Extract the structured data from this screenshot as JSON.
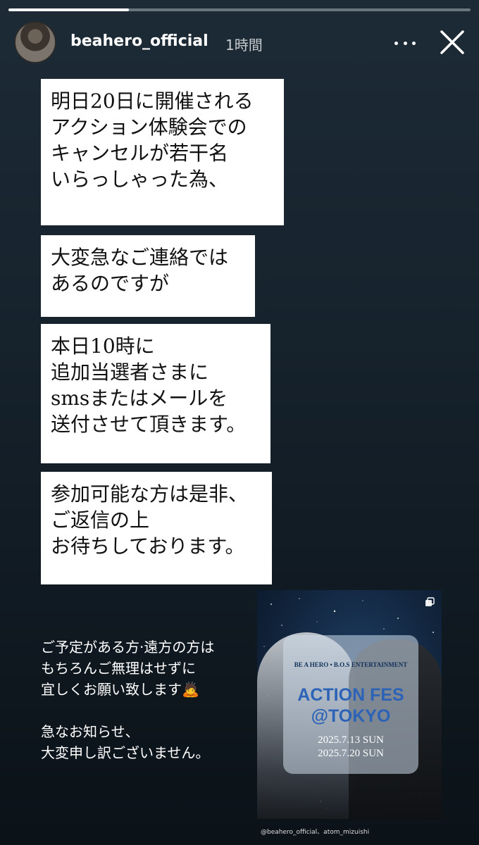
{
  "story": {
    "progress": 0.26
  },
  "header": {
    "username": "beahero_official",
    "time": "1時間",
    "more_icon": "more-horizontal-icon",
    "close_icon": "close-icon"
  },
  "bubbles": [
    "明日20日に開催される\nアクション体験会での\nキャンセルが若干名\nいらっしゃった為、",
    "大変急なご連絡では\nあるのですが",
    "本日10時に\n追加当選者さまに\nsmsまたはメールを\n送付させて頂きます。",
    "参加可能な方は是非、\nご返信の上\nお待ちしております。"
  ],
  "note": "ご予定がある方·遠方の方は\nもちろんご無理はせずに\n宜しくお願い致します🙇\n\n急なお知らせ、\n大変申し訳ございません。",
  "poster": {
    "org": "BE A HERO • B.O.S ENTERTAINMENT",
    "title": "ACTION FES\n@TOKYO",
    "dates": "2025.7.13  SUN\n2025.7.20  SUN",
    "copy_icon": "copy-icon"
  },
  "credit": "@beahero_official、atom_mizuishi"
}
